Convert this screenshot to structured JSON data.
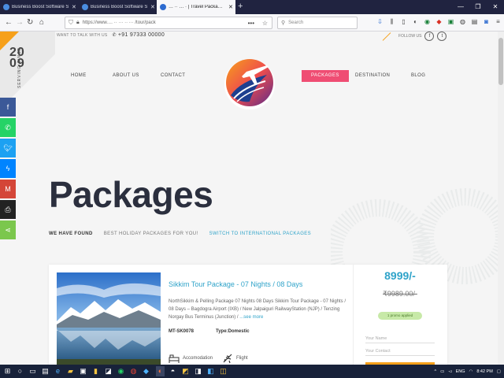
{
  "browser": {
    "tabs": [
      {
        "title": "Business Boost Software Soluti…"
      },
      {
        "title": "Business Boost Software Soluti…"
      },
      {
        "title": "… ·· … · | Travel Packa…"
      }
    ],
    "url": "https://www.… ·· ··· ·· ··· /tour/pack",
    "search_placeholder": "Search"
  },
  "site": {
    "since_year_line1": "20",
    "since_year_line2": "09",
    "since_label": "SERVING SINCE",
    "talk_label": "WANT TO TALK WITH US",
    "phone": "+91 97333 00000",
    "follow_label": "FOLLOW US",
    "follow_icons": [
      "facebook-icon",
      "twitter-icon"
    ]
  },
  "menu": {
    "items": [
      "HOME",
      "ABOUT US",
      "CONTACT",
      "PACKAGES",
      "DESTINATION",
      "BLOG"
    ],
    "active": "PACKAGES"
  },
  "social_bar": [
    {
      "icon": "facebook-icon",
      "color": "#3b5998"
    },
    {
      "icon": "whatsapp-icon",
      "color": "#25d366"
    },
    {
      "icon": "twitter-icon",
      "color": "#1da1f2"
    },
    {
      "icon": "messenger-icon",
      "color": "#0084ff"
    },
    {
      "icon": "gmail-icon",
      "color": "#d44638"
    },
    {
      "icon": "print-icon",
      "color": "#222222"
    },
    {
      "icon": "share-icon",
      "color": "#7bc74d"
    }
  ],
  "hero": {
    "title": "Packages",
    "found_label": "WE HAVE FOUND",
    "subtitle": "BEST HOLIDAY PACKAGES FOR YOU!",
    "switch_link": "SWITCH TO INTERNATIONAL PACKAGES"
  },
  "package": {
    "title": "Sikkim Tour Package - 07 Nights / 08 Days",
    "description": "NorthSikkim & Pelling Package 07 Nights 08 Days   Sikkim Tour Package  -  07 Nights / 08 Days – Bagdogra Airport (IXB) / New Jalpaiguri RailwayStation (NJP) / Tenzing Norgay Bus Terminus (Junction) /",
    "see_more": "...see more",
    "code": "MT-SK0078",
    "type_label": "Type:",
    "type_value": "Domestic",
    "amenities": [
      {
        "label": "Accomodation",
        "icon": "bed-icon"
      },
      {
        "label": "Flight",
        "icon": "airplane-icon"
      }
    ],
    "price": "8999/-",
    "old_price": "₹9989.00/-",
    "promo": "1 promo applied",
    "name_placeholder": "Your Name",
    "contact_placeholder": "Your Contact"
  },
  "taskbar": {
    "language": "ENG",
    "time": "8:42 PM"
  },
  "colors": {
    "accent_pink": "#ef4d73",
    "accent_blue": "#2fa3c9",
    "accent_orange": "#f6a01a",
    "title_dark": "#2b2f3e"
  }
}
